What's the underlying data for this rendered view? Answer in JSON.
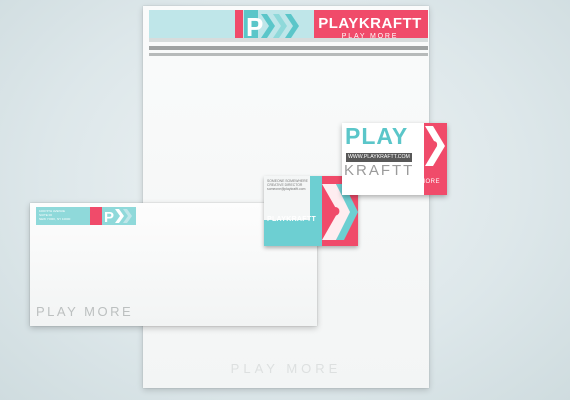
{
  "letterhead": {
    "brand": "PLAYKRAFTT",
    "tagline": "PLAY MORE",
    "footer": "PLAY MORE"
  },
  "envelope": {
    "address_lines": [
      "1000 5TH AVENUE",
      "SUITE 00",
      "NEW YORK, NY 10000"
    ],
    "footer": "PLAY MORE"
  },
  "card_small": {
    "name_lines": [
      "SOMEONE SOMEWHERE",
      "CREATIVE DIRECTOR",
      "someone@playkraftt.com"
    ],
    "brand": "PLAYKRAFTT"
  },
  "card_large": {
    "play": "PLAY",
    "url": "WWW.PLAYKRAFTT.COM",
    "kraftt": "KRAFTT",
    "tagline": "PLAY MORE"
  },
  "colors": {
    "teal": "#5bc6c9",
    "pink": "#f04b6a",
    "grey": "#9fa2a2"
  }
}
